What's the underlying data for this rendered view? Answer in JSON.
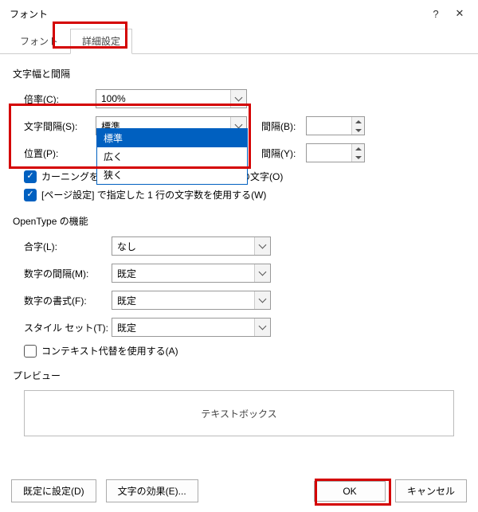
{
  "dialog": {
    "title": "フォント"
  },
  "tabs": {
    "font": "フォント",
    "advanced": "詳細設定"
  },
  "section1": {
    "title": "文字幅と間隔",
    "scale_label": "倍率(C):",
    "scale_value": "100%",
    "spacing_label": "文字間隔(S):",
    "spacing_value": "標準",
    "spacing_options": {
      "a": "標準",
      "b": "広く",
      "c": "狭く"
    },
    "by1_label": "間隔(B):",
    "pos_label": "位置(P):",
    "by2_label": "間隔(Y):",
    "kerning1": "カーニングを行",
    "kerning2": "ト以上の文字(O)",
    "grid": "[ページ設定] で指定した 1 行の文字数を使用する(W)"
  },
  "section2": {
    "title": "OpenType の機能",
    "lig_label": "合字(L):",
    "lig_value": "なし",
    "numspacing_label": "数字の間隔(M):",
    "numspacing_value": "既定",
    "numform_label": "数字の書式(F):",
    "numform_value": "既定",
    "styleset_label": "スタイル セット(T):",
    "styleset_value": "既定",
    "contextual": "コンテキスト代替を使用する(A)"
  },
  "preview": {
    "title": "プレビュー",
    "sample": "テキストボックス"
  },
  "footer": {
    "setdefault": "既定に設定(D)",
    "texteffects": "文字の効果(E)...",
    "ok": "OK",
    "cancel": "キャンセル"
  }
}
